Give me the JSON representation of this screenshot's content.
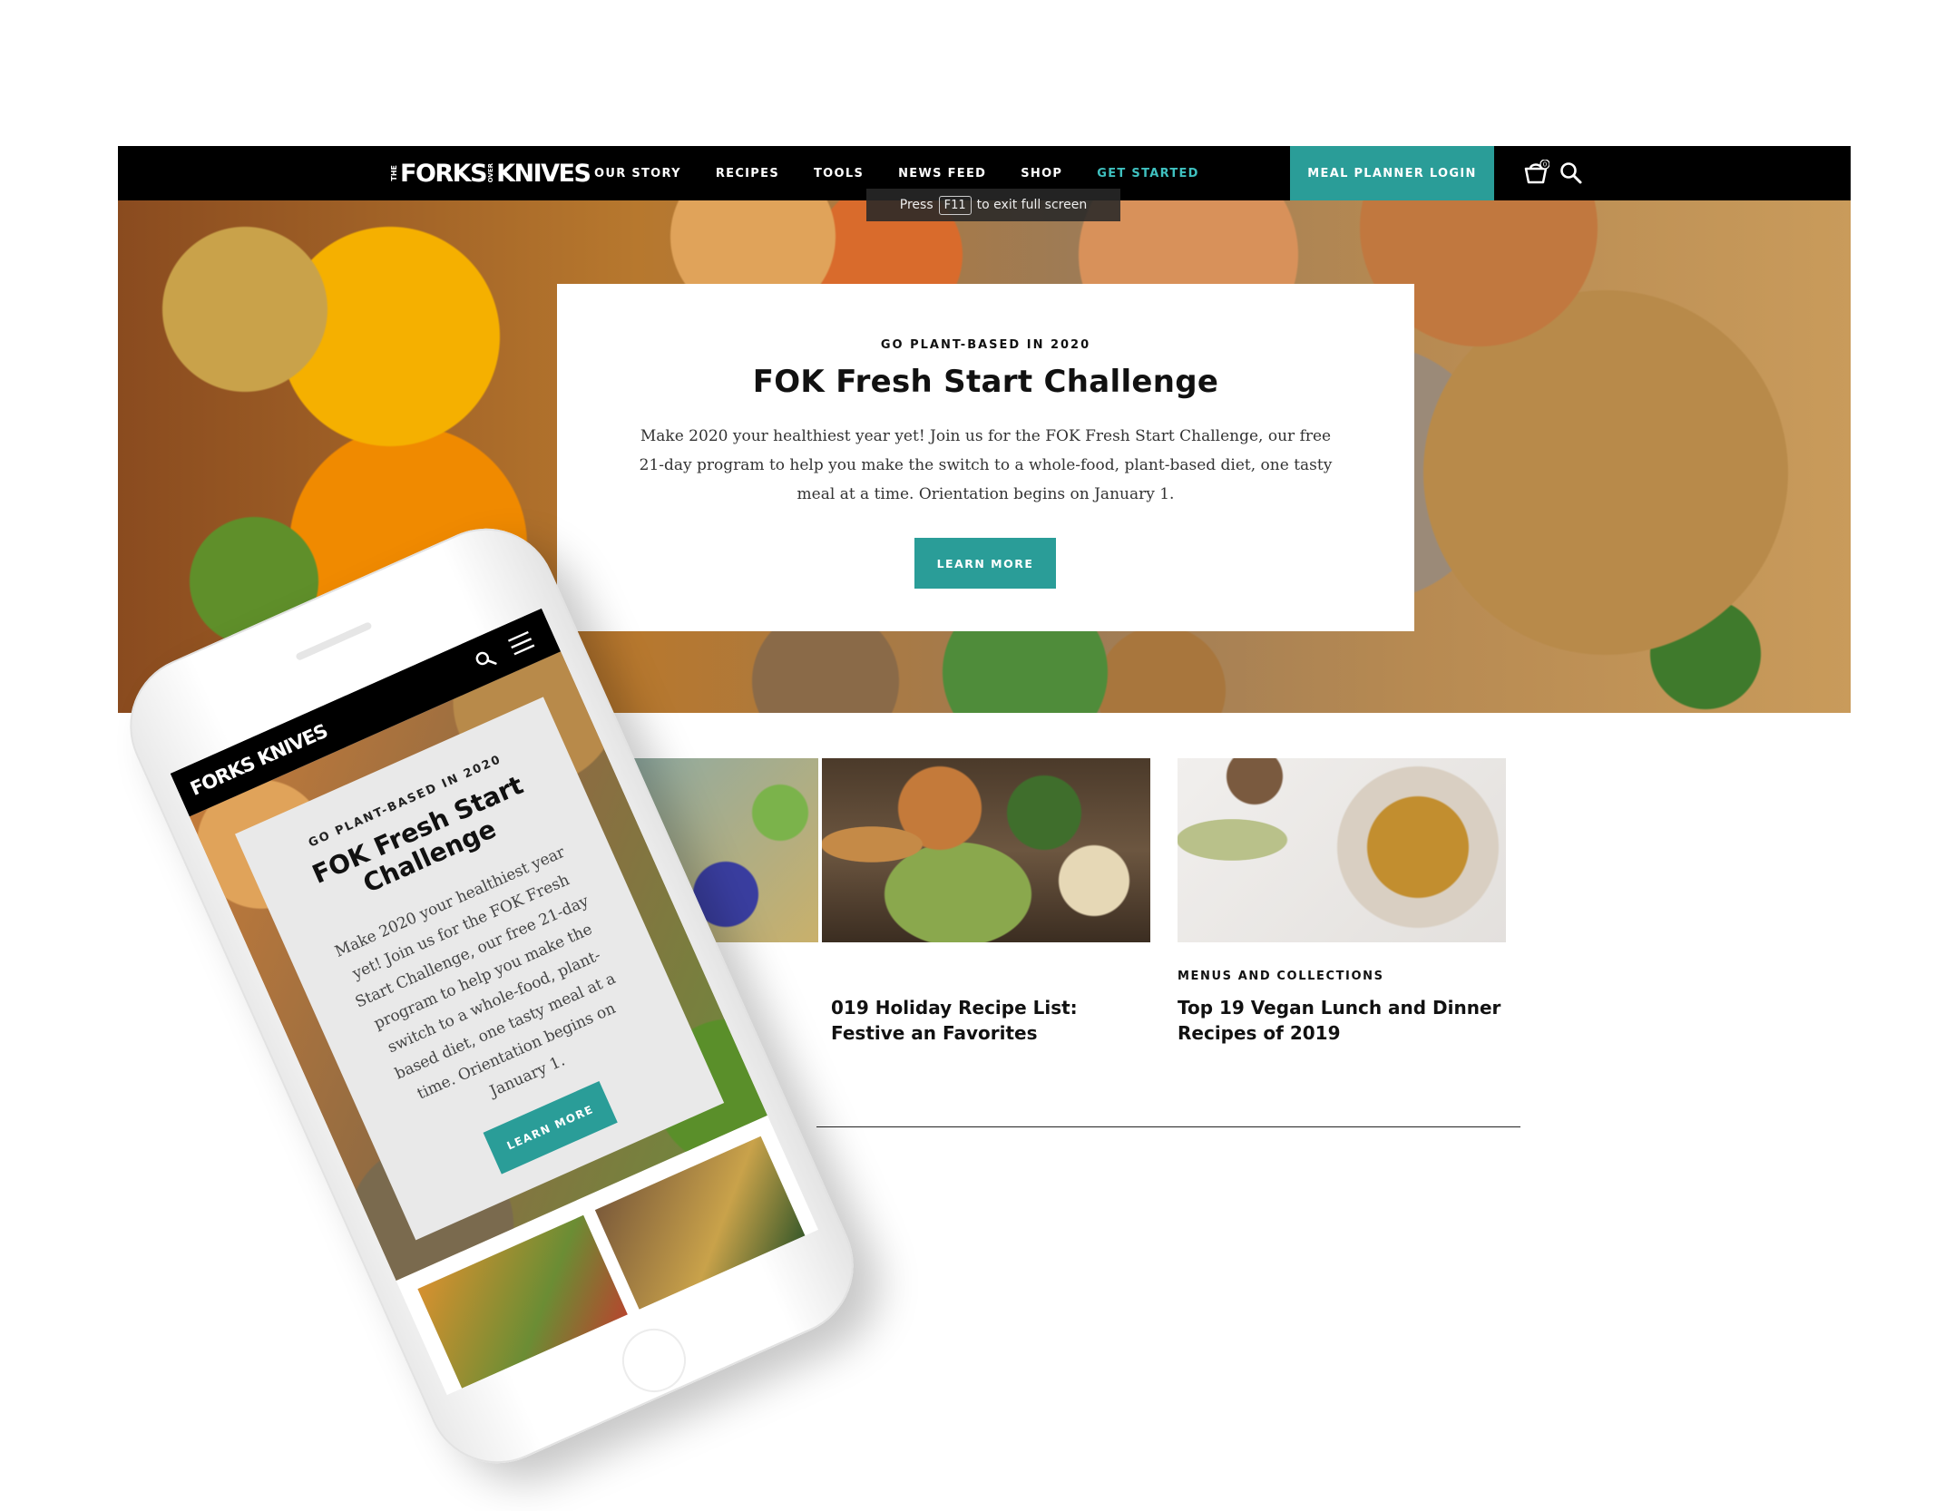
{
  "desktop": {
    "logo": {
      "pre": "THE",
      "part1": "FORKS",
      "over": "OVER",
      "part2": "KNIVES"
    },
    "nav": [
      {
        "label": "OUR STORY"
      },
      {
        "label": "RECIPES"
      },
      {
        "label": "TOOLS"
      },
      {
        "label": "NEWS FEED"
      },
      {
        "label": "SHOP"
      },
      {
        "label": "GET STARTED"
      }
    ],
    "meal_planner_label": "MEAL PLANNER LOGIN",
    "cart_count": "0",
    "fullscreen_notice": {
      "pre": "Press",
      "key": "F11",
      "post": "to exit full screen"
    },
    "hero": {
      "kicker": "GO PLANT-BASED IN 2020",
      "title": "FOK Fresh Start Challenge",
      "body": "Make 2020 your healthiest year yet! Join us for the FOK Fresh Start Challenge, our free 21-day program to help you make the switch to a whole-food, plant-based diet, one tasty meal at a time.  Orientation begins on January 1.",
      "button_label": "LEARN MORE"
    },
    "cards": [
      {
        "kicker": "",
        "title": ""
      },
      {
        "kicker": "",
        "title": "019 Holiday Recipe List: Festive an Favorites"
      },
      {
        "kicker": "MENUS AND COLLECTIONS",
        "title": "Top 19 Vegan Lunch and Dinner Recipes of 2019"
      }
    ]
  },
  "mobile": {
    "logo": "FORKS KNIVES",
    "hero": {
      "kicker": "GO PLANT-BASED IN 2020",
      "title": "FOK Fresh Start Challenge",
      "body": "Make 2020 your healthiest year yet! Join us for the FOK Fresh Start Challenge, our free 21-day program to help you make the switch to a whole-food, plant-based diet, one tasty meal at a time.  Orientation begins on January 1.",
      "button_label": "LEARN MORE"
    }
  },
  "colors": {
    "accent": "#2a9d98",
    "accent_text": "#3fc1c0",
    "nav_bg": "#000000"
  }
}
